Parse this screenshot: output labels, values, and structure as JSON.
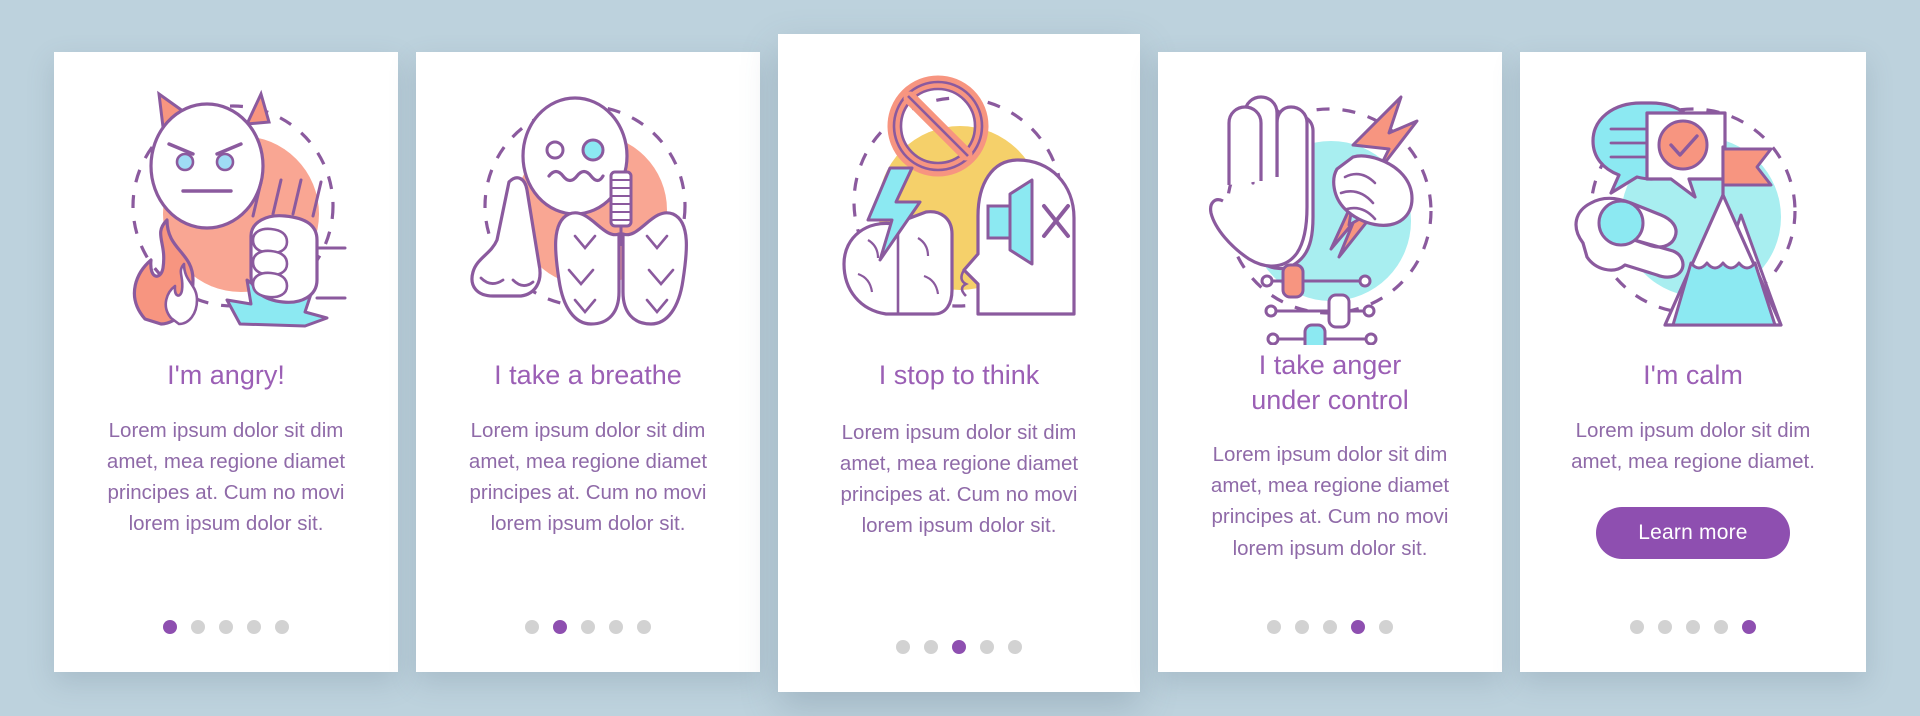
{
  "page": {
    "background_color": "#bdd2dd",
    "card_background": "#ffffff",
    "accent_color": "#8e4fb0",
    "title_color": "#9b5fb5",
    "body_color": "#8f6aa8",
    "outline_color": "#8b5a9e",
    "salmon": "#f79580",
    "peach_fill": "#f9a693",
    "cyan": "#7fe9ef",
    "cyan_fill": "#a8eef0",
    "yellow_fill": "#f5d06a",
    "dot_inactive": "#d2d2d2"
  },
  "cards": [
    {
      "id": "card-angry",
      "title": "I'm angry!",
      "body": "Lorem ipsum dolor sit dim amet, mea regione diamet principes at. Cum no movi lorem ipsum dolor sit.",
      "illustration": "angry-devil-face-fist-fire-icon",
      "circle_color": "#f9a693",
      "dots": {
        "total": 5,
        "active": 1
      },
      "button": null
    },
    {
      "id": "card-breathe",
      "title": "I take a breathe",
      "body": "Lorem ipsum dolor sit dim amet, mea regione diamet principes at. Cum no movi lorem ipsum dolor sit.",
      "illustration": "face-nose-lungs-breathing-icon",
      "circle_color": "#f9a693",
      "dots": {
        "total": 5,
        "active": 2
      },
      "button": null
    },
    {
      "id": "card-stop-to-think",
      "title": "I stop to think",
      "body": "Lorem ipsum dolor sit dim amet, mea regione diamet principes at. Cum no movi lorem ipsum dolor sit.",
      "illustration": "brain-lightning-head-mute-prohibition-icon",
      "circle_color": "#f5d06a",
      "dots": {
        "total": 5,
        "active": 3
      },
      "button": null
    },
    {
      "id": "card-anger-control",
      "title": "I take anger\nunder control",
      "body": "Lorem ipsum dolor sit dim amet, mea regione diamet principes at. Cum no movi lorem ipsum dolor sit.",
      "illustration": "stop-hand-fist-lightning-sliders-icon",
      "circle_color": "#a8eef0",
      "dots": {
        "total": 5,
        "active": 4
      },
      "button": null
    },
    {
      "id": "card-calm",
      "title": "I'm calm",
      "body": "Lorem ipsum dolor sit dim amet, mea regione diamet.",
      "illustration": "chat-check-ok-hand-mountain-flag-icon",
      "circle_color": "#a8eef0",
      "dots": {
        "total": 5,
        "active": 5
      },
      "button": {
        "label": "Learn more"
      }
    }
  ]
}
